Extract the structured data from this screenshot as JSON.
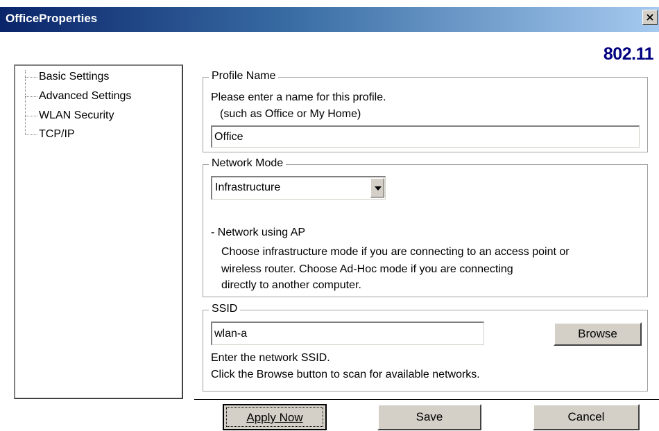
{
  "window": {
    "title": "OfficeProperties",
    "close_glyph": "×"
  },
  "brand": "802.11",
  "tree": {
    "items": [
      "Basic Settings",
      "Advanced Settings",
      "WLAN Security",
      "TCP/IP"
    ]
  },
  "profile_name": {
    "legend": "Profile Name",
    "instruction": "Please enter a name for this profile.",
    "hint": "(such as Office or My Home)",
    "value": "Office"
  },
  "network_mode": {
    "legend": "Network Mode",
    "selected": "Infrastructure",
    "desc_title": "- Network using AP",
    "desc_lines": [
      "Choose infrastructure mode if you are connecting to an access point or",
      "wireless router. Choose Ad-Hoc mode if you are connecting",
      "directly to another computer."
    ]
  },
  "ssid": {
    "legend": "SSID",
    "value": "wlan-a",
    "browse_label": "Browse",
    "help_line1": "Enter the network SSID.",
    "help_line2": "Click the Browse button to scan for available networks."
  },
  "footer": {
    "apply_label": "Apply Now",
    "save_label": "Save",
    "cancel_label": "Cancel"
  },
  "colors": {
    "titlebar_start": "#0a246a",
    "titlebar_end": "#a6caf0",
    "brand": "#000080",
    "button_face": "#d4d0c8"
  }
}
